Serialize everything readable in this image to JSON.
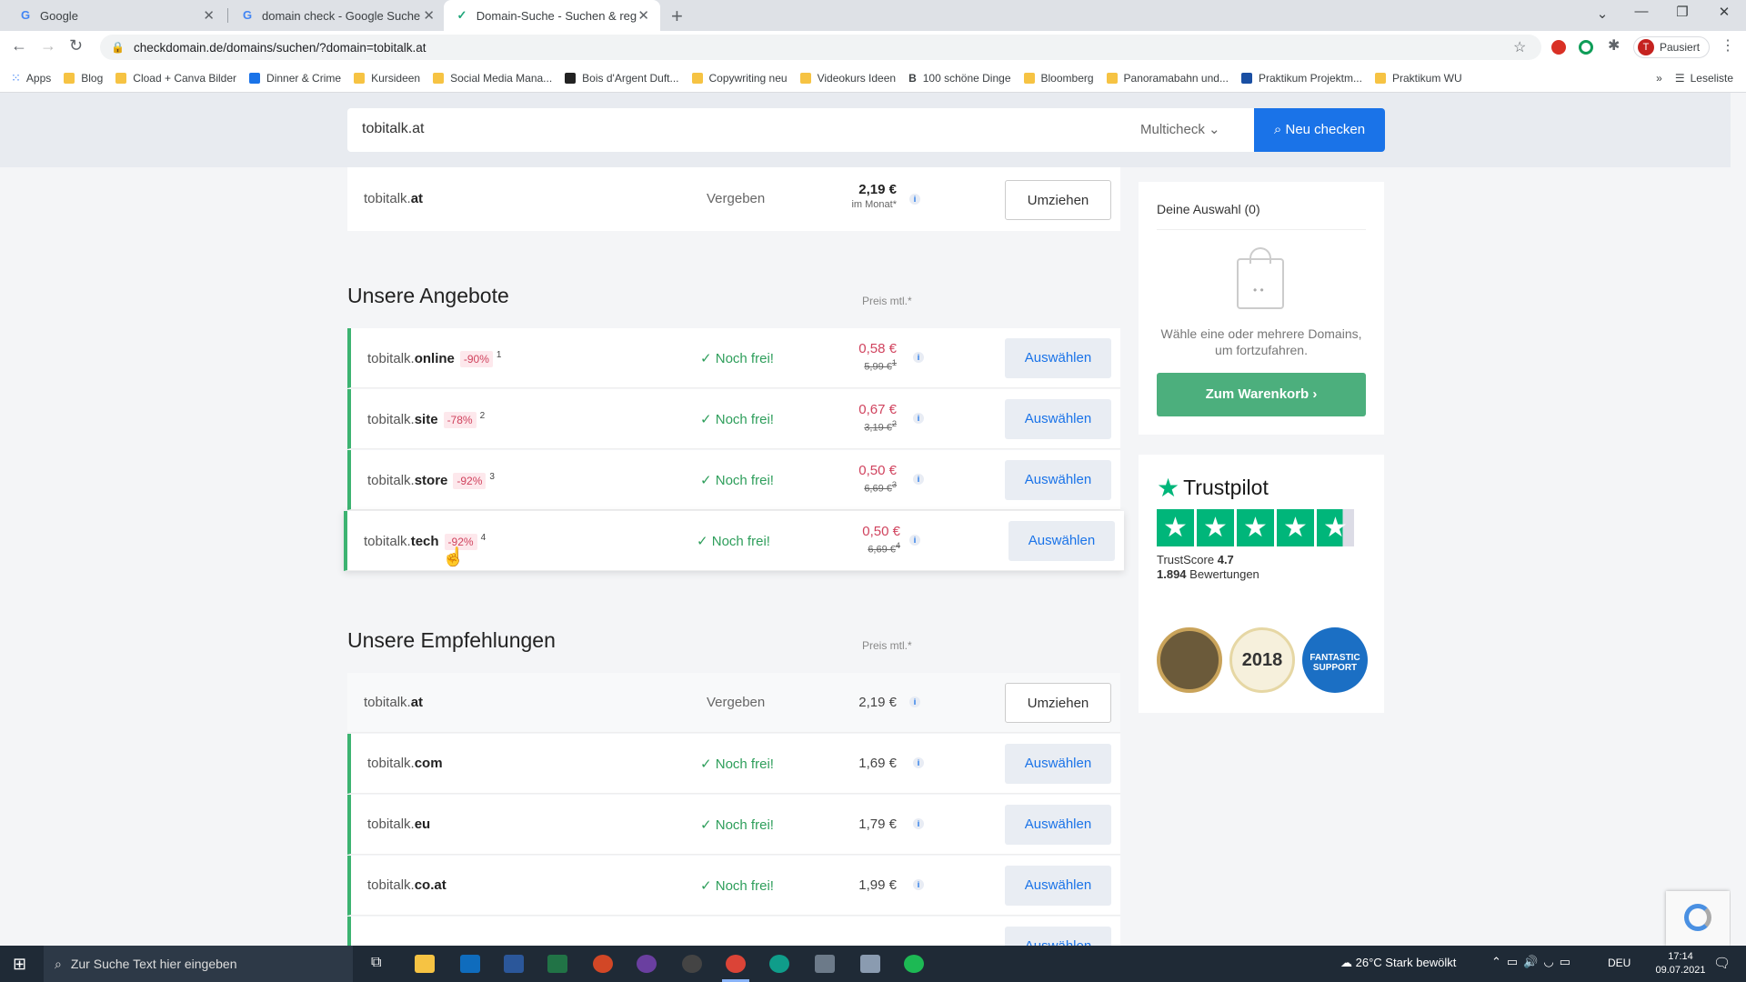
{
  "browser": {
    "tabs": [
      {
        "label": "Google",
        "favicon": "G"
      },
      {
        "label": "domain check - Google Suche",
        "favicon": "G"
      },
      {
        "label": "Domain-Suche - Suchen & regist",
        "favicon": "✓"
      }
    ],
    "url": "checkdomain.de/domains/suchen/?domain=tobitalk.at",
    "profile_label": "Pausiert",
    "bookmarks": [
      "Apps",
      "Blog",
      "Cload + Canva Bilder",
      "Dinner & Crime",
      "Kursideen",
      "Social Media Mana...",
      "Bois d'Argent Duft...",
      "Copywriting neu",
      "Videokurs Ideen",
      "100 schöne Dinge",
      "Bloomberg",
      "Panoramabahn und...",
      "Praktikum Projektm...",
      "Praktikum WU"
    ],
    "reading_list": "Leseliste"
  },
  "search": {
    "value": "tobitalk.at",
    "mode": "Multicheck",
    "button": "Neu checken"
  },
  "top_row": {
    "name": "tobitalk.",
    "tld": "at",
    "status": "Vergeben",
    "price": "2,19 €",
    "price_note": "im Monat*",
    "button": "Umziehen"
  },
  "offers": {
    "heading": "Unsere Angebote",
    "price_header": "Preis mtl.*",
    "rows": [
      {
        "name": "tobitalk.",
        "tld": "online",
        "discount": "-90%",
        "fn": "1",
        "status": "Noch frei!",
        "price": "0,58 €",
        "old": "5,99 €",
        "oldfn": "1",
        "button": "Auswählen"
      },
      {
        "name": "tobitalk.",
        "tld": "site",
        "discount": "-78%",
        "fn": "2",
        "status": "Noch frei!",
        "price": "0,67 €",
        "old": "3,19 €",
        "oldfn": "2",
        "button": "Auswählen"
      },
      {
        "name": "tobitalk.",
        "tld": "store",
        "discount": "-92%",
        "fn": "3",
        "status": "Noch frei!",
        "price": "0,50 €",
        "old": "6,69 €",
        "oldfn": "3",
        "button": "Auswählen"
      },
      {
        "name": "tobitalk.",
        "tld": "tech",
        "discount": "-92%",
        "fn": "4",
        "status": "Noch frei!",
        "price": "0,50 €",
        "old": "6,69 €",
        "oldfn": "4",
        "button": "Auswählen"
      }
    ]
  },
  "recommendations": {
    "heading": "Unsere Empfehlungen",
    "price_header": "Preis mtl.*",
    "rows": [
      {
        "name": "tobitalk.",
        "tld": "at",
        "status": "Vergeben",
        "price": "2,19 €",
        "button": "Umziehen"
      },
      {
        "name": "tobitalk.",
        "tld": "com",
        "status": "Noch frei!",
        "price": "1,69 €",
        "button": "Auswählen"
      },
      {
        "name": "tobitalk.",
        "tld": "eu",
        "status": "Noch frei!",
        "price": "1,79 €",
        "button": "Auswählen"
      },
      {
        "name": "tobitalk.",
        "tld": "co.at",
        "status": "Noch frei!",
        "price": "1,99 €",
        "button": "Auswählen"
      }
    ]
  },
  "cart": {
    "title": "Deine Auswahl (0)",
    "empty_text": "Wähle eine oder mehrere Domains, um fortzufahren.",
    "button": "Zum Warenkorb"
  },
  "trustpilot": {
    "brand": "Trustpilot",
    "score_label": "TrustScore",
    "score": "4.7",
    "reviews_count": "1.894",
    "reviews_label": "Bewertungen",
    "badge_year": "2018",
    "badge_support": "FANTASTIC SUPPORT"
  },
  "taskbar": {
    "search_placeholder": "Zur Suche Text hier eingeben",
    "weather": "26°C  Stark bewölkt",
    "lang": "DEU",
    "time": "17:14",
    "date": "09.07.2021"
  },
  "colors": {
    "accent": "#1a73e8",
    "free": "#2e9e5b",
    "discount": "#d0435e",
    "trustpilot": "#00b67a",
    "cta": "#4caf7d"
  }
}
